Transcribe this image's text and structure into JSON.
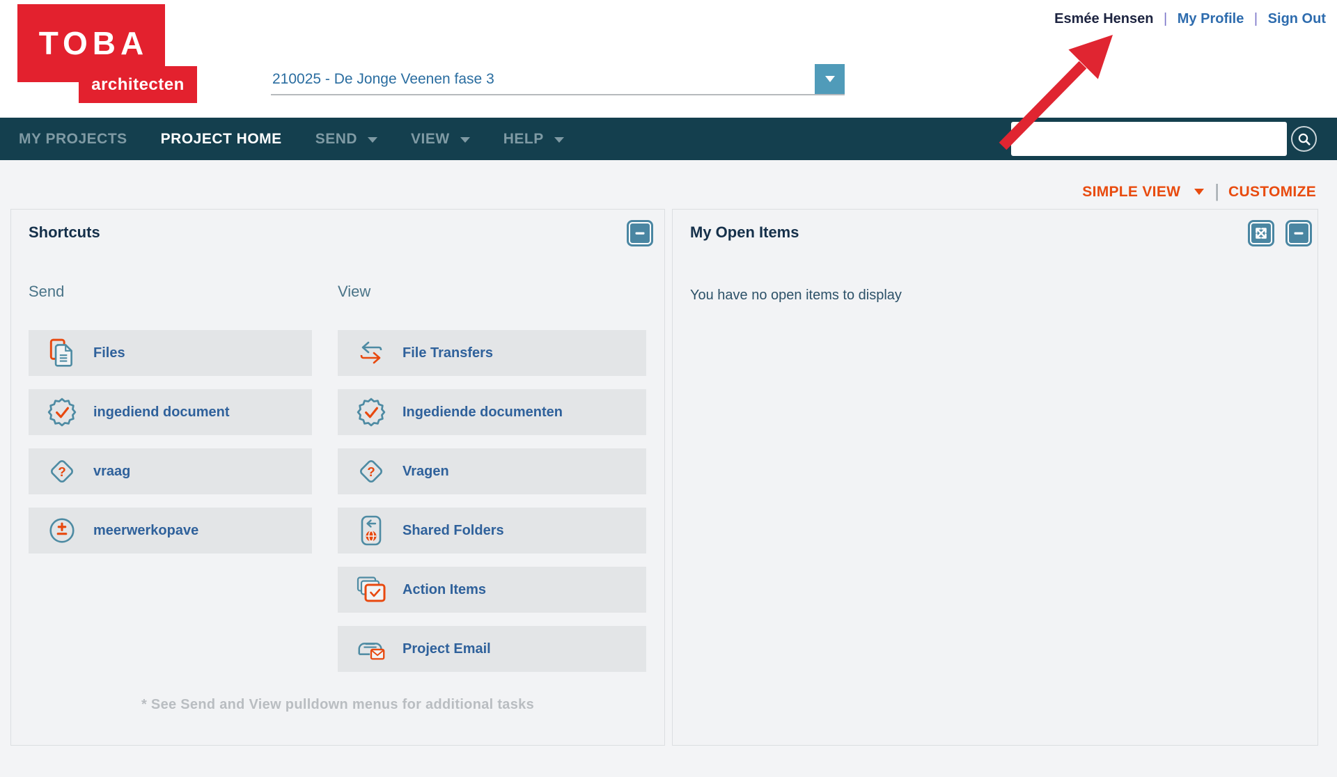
{
  "logo": {
    "line1": "TOBA",
    "line2": "architecten"
  },
  "user_bar": {
    "name": "Esmée Hensen",
    "separator": "|",
    "links": [
      {
        "label": "My Profile"
      },
      {
        "label": "Sign Out"
      }
    ]
  },
  "project_selector": {
    "value": "210025 - De Jonge Veenen fase 3",
    "dropdown_icon": "chevron-down-icon"
  },
  "nav": {
    "items": [
      {
        "label": "MY PROJECTS",
        "active": false,
        "has_caret": false
      },
      {
        "label": "PROJECT HOME",
        "active": true,
        "has_caret": false
      },
      {
        "label": "SEND",
        "active": false,
        "has_caret": true
      },
      {
        "label": "VIEW",
        "active": false,
        "has_caret": true
      },
      {
        "label": "HELP",
        "active": false,
        "has_caret": true
      }
    ],
    "search": {
      "value": "",
      "icon": "search-icon"
    }
  },
  "view_controls": {
    "view_mode": "SIMPLE VIEW",
    "separator": "|",
    "customize": "CUSTOMIZE"
  },
  "panels": {
    "shortcuts": {
      "title": "Shortcuts",
      "minimize_icon": "minimize-icon",
      "columns": [
        {
          "heading": "Send",
          "items": [
            {
              "label": "Files",
              "icon": "files-icon"
            },
            {
              "label": "ingediend document",
              "icon": "seal-check-icon"
            },
            {
              "label": "vraag",
              "icon": "question-diamond-icon"
            },
            {
              "label": "meerwerkopave",
              "icon": "plus-minus-circle-icon"
            }
          ]
        },
        {
          "heading": "View",
          "items": [
            {
              "label": "File Transfers",
              "icon": "transfer-arrows-icon"
            },
            {
              "label": "Ingediende documenten",
              "icon": "seal-check-icon"
            },
            {
              "label": "Vragen",
              "icon": "question-diamond-icon"
            },
            {
              "label": "Shared Folders",
              "icon": "shared-folder-icon"
            },
            {
              "label": "Action Items",
              "icon": "action-items-icon"
            },
            {
              "label": "Project Email",
              "icon": "project-email-icon"
            }
          ]
        }
      ],
      "footnote": "* See Send and View pulldown menus for additional tasks"
    },
    "my_open_items": {
      "title": "My Open Items",
      "expand_icon": "expand-icon",
      "minimize_icon": "minimize-icon",
      "empty_message": "You have no open items to display"
    }
  },
  "annotation": {
    "type": "red-arrow",
    "points_to": "My Profile",
    "color": "#e02531"
  },
  "colors": {
    "logo_red": "#e3212e",
    "navbar_teal": "#143f4e",
    "accent_orange": "#e84b0f",
    "icon_teal": "#4e8ba3",
    "link_blue": "#2e6cae",
    "item_bar_gray": "#e3e5e7",
    "panel_button_teal": "#4a86a2"
  }
}
